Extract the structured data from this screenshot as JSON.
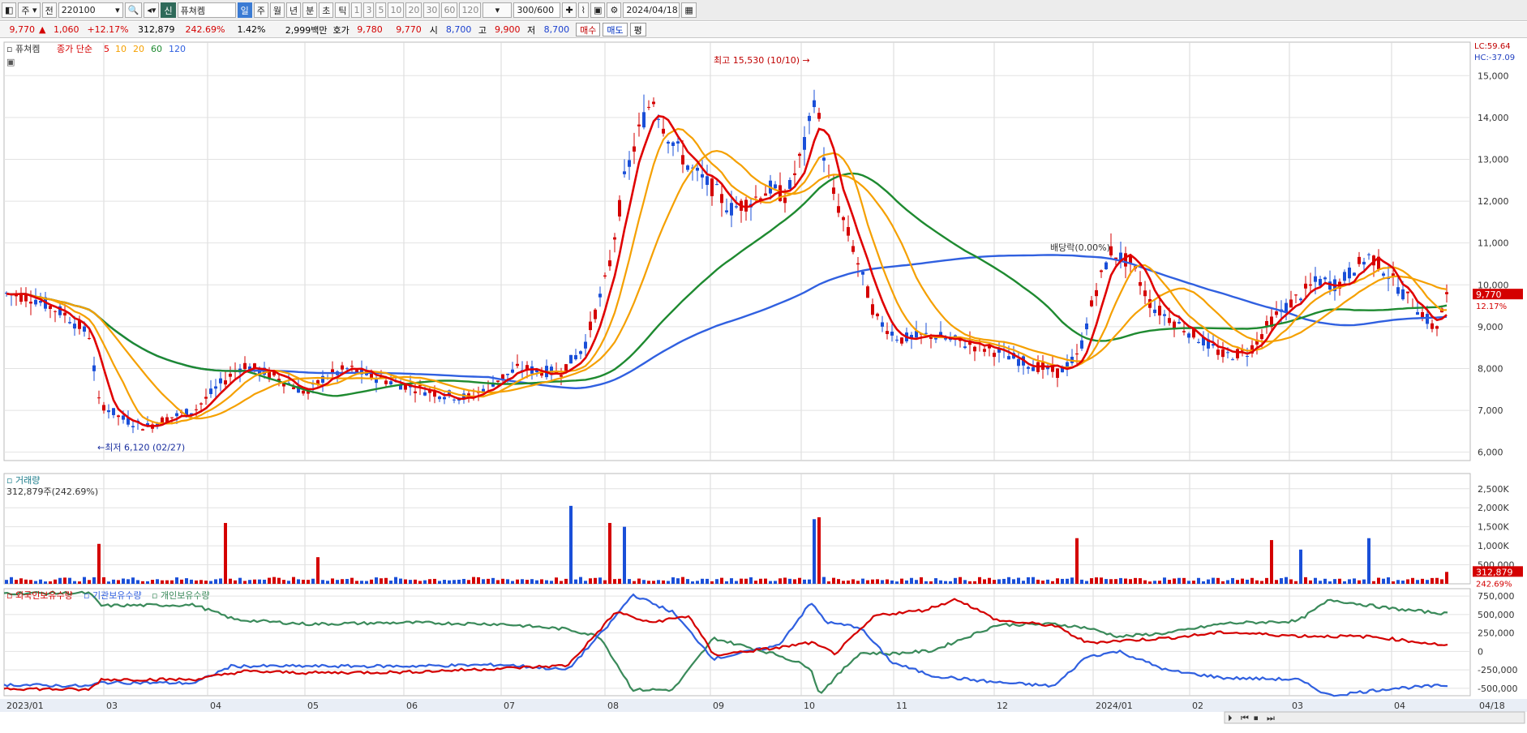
{
  "toolbar": {
    "market": "주",
    "scope": "전",
    "code": "220100",
    "badge": "신",
    "name": "퓨쳐켐",
    "periods": [
      "일",
      "주",
      "월",
      "년",
      "분",
      "초",
      "틱"
    ],
    "intervals": [
      "1",
      "3",
      "5",
      "10",
      "20",
      "30",
      "60",
      "120"
    ],
    "count": "300/600",
    "date": "2024/04/18"
  },
  "quote": {
    "price": "9,770",
    "arrow": "▲",
    "change": "1,060",
    "change_pct": "+12.17%",
    "volume": "312,879",
    "volume_pct": "242.69%",
    "turnover_pct": "1.42%",
    "amount": "2,999백만",
    "hoga_label": "호가",
    "ask": "9,780",
    "bid": "9,770",
    "open_label": "시",
    "open": "8,700",
    "high_label": "고",
    "high": "9,900",
    "low_label": "저",
    "low": "8,700",
    "buy": "매수",
    "sell": "매도",
    "extra": "평"
  },
  "colors": {
    "up": "#d40000",
    "down": "#1a4fd8",
    "ma5": "#e00000",
    "ma10": "#f5a000",
    "ma20": "#f5a000",
    "ma60": "#1e8a30",
    "ma120": "#3060e0",
    "foreign": "#d40000",
    "institution": "#3060e0",
    "individual": "#3a8a5a"
  },
  "chart_data": [
    {
      "type": "line",
      "title": "퓨쳐켐",
      "legend_prefix": "종가 단순",
      "ma_periods": [
        "5",
        "10",
        "20",
        "60",
        "120"
      ],
      "x_ticks": [
        "2023/01",
        "03",
        "04",
        "05",
        "06",
        "07",
        "08",
        "09",
        "10",
        "11",
        "12",
        "2024/01",
        "02",
        "03",
        "04",
        "04/18"
      ],
      "ylim": [
        5800,
        15800
      ],
      "y_ticks": [
        6000,
        7000,
        8000,
        9000,
        10000,
        11000,
        12000,
        13000,
        14000,
        15000
      ],
      "y_tick_labels": [
        "6,000",
        "7,000",
        "8,000",
        "9,000",
        "10,000",
        "11,000",
        "12,000",
        "13,000",
        "14,000",
        "15,000"
      ],
      "series": [
        {
          "name": "5",
          "months": [
            0,
            0.4,
            0.8,
            1.2,
            1.6,
            2.0,
            2.3,
            2.6,
            3.0,
            3.5,
            4.0,
            4.5,
            5.0,
            5.5,
            6.0,
            6.5,
            7.0,
            7.5,
            8.0,
            8.3,
            8.6,
            9.0,
            9.5,
            10.0,
            10.3,
            10.6,
            11.0,
            11.5,
            12.0,
            12.3,
            12.6,
            13.0,
            13.5,
            14.0,
            14.3,
            14.6,
            15.0,
            15.3,
            15.6,
            16.0,
            16.3,
            16.6,
            17.0,
            17.3,
            17.6,
            18.0,
            18.3,
            18.6,
            19.0,
            19.5,
            20.0,
            20.3,
            20.6,
            21.0,
            21.3,
            21.6,
            22.0,
            22.3,
            22.6,
            23.0,
            23.3,
            23.6,
            24.0,
            24.3,
            24.6,
            25.0,
            25.3,
            25.6,
            26.0,
            26.3,
            26.6,
            27.0,
            27.3,
            27.6,
            28.0,
            28.5,
            29.0,
            29.5,
            30.0,
            30.3,
            30.6,
            31.0,
            31.3,
            31.6,
            32.0,
            32.3,
            32.6,
            33.0,
            33.3,
            33.6,
            34.0,
            34.3,
            34.6,
            35.0,
            35.3,
            35.6,
            36.0,
            36.3,
            36.6,
            37.0,
            37.3,
            37.6,
            38.0,
            38.3,
            38.6,
            39.0,
            39.3,
            39.6,
            40.0,
            40.3,
            40.6,
            41.0,
            41.3,
            41.6,
            42.0,
            42.3,
            42.6,
            43.0,
            43.3,
            43.6,
            44.0,
            44.3,
            44.6,
            45.0,
            45.3,
            45.6,
            46.0,
            46.3,
            46.6,
            47.0,
            47.3,
            47.6,
            48.0,
            48.3,
            48.6,
            49.0,
            49.3,
            49.6,
            50.0,
            50.3,
            50.6,
            51.0,
            51.3,
            51.6,
            52.0,
            52.3,
            52.6,
            53.0,
            53.3,
            53.6,
            54.0,
            54.3,
            54.6,
            55.0,
            55.3,
            55.6,
            56.0,
            56.3,
            56.6,
            57.0,
            57.3,
            57.6,
            58.0,
            58.3,
            58.6,
            59.0,
            59.3,
            59.6,
            60.0,
            60.3,
            60.6,
            61.0,
            61.3,
            61.6,
            62.0,
            62.3,
            62.6,
            63.0,
            63.3,
            63.6,
            64.0,
            64.3,
            64.6,
            65.0,
            65.3,
            65.6,
            66.0,
            66.3,
            66.6,
            67.0,
            67.3,
            67.6,
            68.0,
            68.3,
            68.6,
            69.0,
            69.3,
            69.6,
            70.0,
            70.3,
            70.6,
            71.0,
            71.3,
            71.6,
            72.0
          ],
          "values": []
        },
        {
          "name": "10"
        },
        {
          "name": "20"
        },
        {
          "name": "60"
        },
        {
          "name": "120"
        }
      ],
      "annotations": {
        "high": "최고 15,530 (10/10)",
        "low": "최저 6,120 (02/27)",
        "dividend": "배당락(0.00%)"
      },
      "right_labels": {
        "lc": "LC:59.64",
        "hc": "HC:-37.09",
        "last_price": "9,770",
        "last_pct": "12.17%"
      }
    },
    {
      "type": "bar",
      "title": "거래량",
      "subtitle": "312,879주(242.69%)",
      "y_tick_labels": [
        "500,000",
        "1,000K",
        "1,500K",
        "2,000K",
        "2,500K"
      ],
      "y_ticks": [
        500000,
        1000000,
        1500000,
        2000000,
        2500000
      ],
      "ylim": [
        0,
        2900000
      ],
      "last_value": "312,879",
      "last_pct": "242.69%"
    },
    {
      "type": "line",
      "legend": [
        "외국인보유수량",
        "기관보유수량",
        "개인보유수량"
      ],
      "ylim": [
        -600000,
        850000
      ],
      "y_ticks": [
        -500000,
        -250000,
        0,
        250000,
        500000,
        750000
      ],
      "y_tick_labels": [
        "-500,000",
        "-250,000",
        "0",
        "250,000",
        "500,000",
        "750,000"
      ]
    }
  ]
}
